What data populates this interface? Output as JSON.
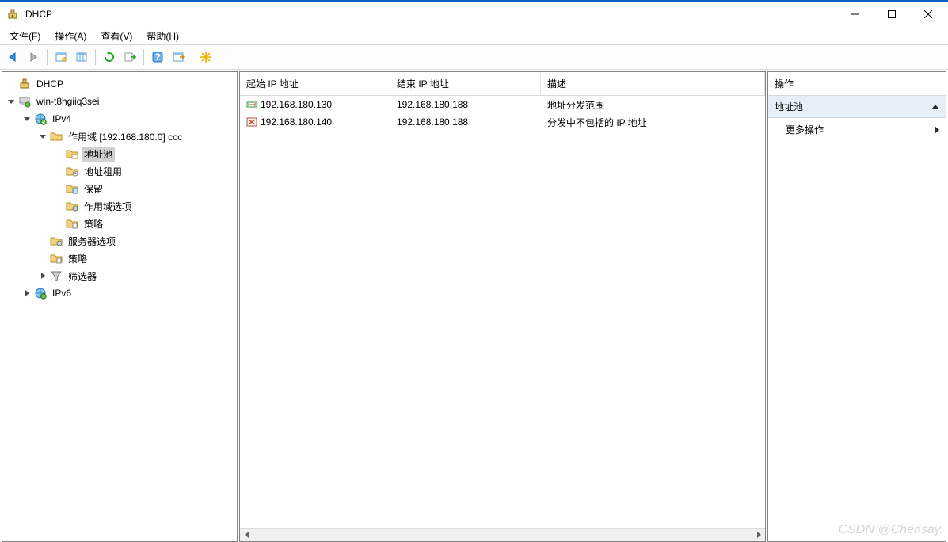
{
  "title": "DHCP",
  "menu": {
    "file": "文件(F)",
    "action": "操作(A)",
    "view": "查看(V)",
    "help": "帮助(H)"
  },
  "tree": {
    "root": "DHCP",
    "server": "win-t8hgiiq3sei",
    "ipv4": "IPv4",
    "scope": "作用域 [192.168.180.0] ccc",
    "pool": "地址池",
    "leases": "地址租用",
    "reservations": "保留",
    "scopeopts": "作用域选项",
    "policies": "策略",
    "serveropts": "服务器选项",
    "policies2": "策略",
    "filters": "筛选器",
    "ipv6": "IPv6"
  },
  "list": {
    "headers": {
      "start": "起始 IP 地址",
      "end": "结束 IP 地址",
      "desc": "描述"
    },
    "rows": [
      {
        "icon": "range",
        "start": "192.168.180.130",
        "end": "192.168.180.188",
        "desc": "地址分发范围"
      },
      {
        "icon": "exclude",
        "start": "192.168.180.140",
        "end": "192.168.180.188",
        "desc": "分发中不包括的 IP 地址"
      }
    ]
  },
  "actions": {
    "title": "操作",
    "section": "地址池",
    "more": "更多操作"
  },
  "watermark": "CSDN @Chensay."
}
